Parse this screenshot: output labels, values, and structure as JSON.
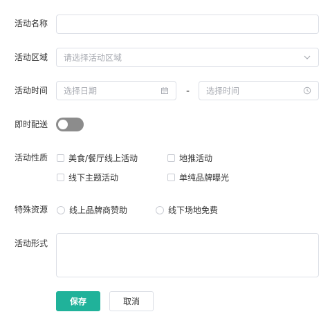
{
  "form": {
    "name_label": "活动名称",
    "name_value": "",
    "area_label": "活动区域",
    "area_placeholder": "请选择活动区域",
    "time_label": "活动时间",
    "date_placeholder": "选择日期",
    "time_separator": "-",
    "time_placeholder": "选择时间",
    "delivery_label": "即时配送",
    "delivery_on": false,
    "nature_label": "活动性质",
    "nature_options": [
      {
        "label": "美食/餐厅线上活动",
        "checked": false
      },
      {
        "label": "地推活动",
        "checked": false
      },
      {
        "label": "线下主题活动",
        "checked": false
      },
      {
        "label": "单纯品牌曝光",
        "checked": false
      }
    ],
    "resource_label": "特殊资源",
    "resource_options": [
      {
        "label": "线上品牌商赞助",
        "selected": false
      },
      {
        "label": "线下场地免费",
        "selected": false
      }
    ],
    "form_label": "活动形式",
    "form_value": "",
    "save_label": "保存",
    "cancel_label": "取消"
  },
  "colors": {
    "primary": "#20b29a",
    "border": "#dcdfe6",
    "placeholder": "#a8abb2",
    "toggle_off": "#8c8c8c"
  },
  "icons": {
    "area_suffix": "chevron-down-icon",
    "date_suffix": "calendar-icon",
    "time_suffix": "clock-icon"
  }
}
